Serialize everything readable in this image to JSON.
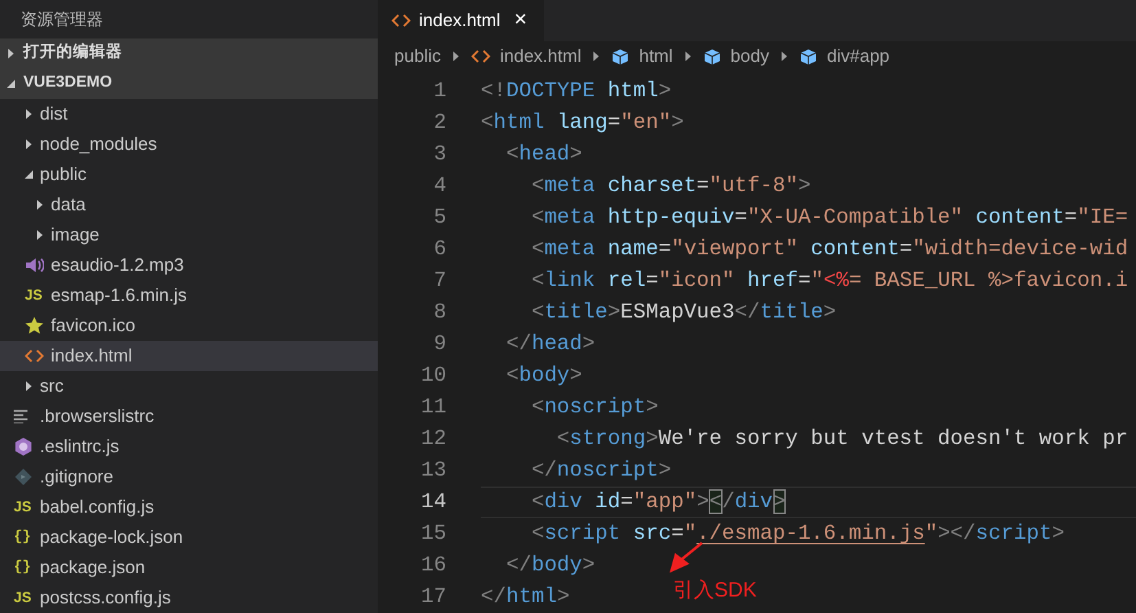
{
  "explorer": {
    "title": "资源管理器",
    "sections": [
      {
        "label": "打开的编辑器",
        "expanded": false
      },
      {
        "label": "VUE3DEMO",
        "expanded": true,
        "children": [
          {
            "label": "dist",
            "kind": "folder",
            "expanded": false,
            "selected": false
          },
          {
            "label": "node_modules",
            "kind": "folder",
            "expanded": false,
            "selected": false
          },
          {
            "label": "public",
            "kind": "folder",
            "expanded": true,
            "selected": false,
            "children": [
              {
                "label": "data",
                "kind": "folder",
                "expanded": false,
                "selected": false
              },
              {
                "label": "image",
                "kind": "folder",
                "expanded": false,
                "selected": false
              },
              {
                "label": "esaudio-1.2.mp3",
                "kind": "audio",
                "selected": false
              },
              {
                "label": "esmap-1.6.min.js",
                "kind": "js",
                "icon": "JS",
                "selected": false
              },
              {
                "label": "favicon.ico",
                "kind": "star",
                "selected": false
              },
              {
                "label": "index.html",
                "kind": "html",
                "selected": true
              }
            ]
          },
          {
            "label": "src",
            "kind": "folder",
            "expanded": false,
            "selected": false
          },
          {
            "label": ".browserslistrc",
            "kind": "text",
            "selected": false
          },
          {
            "label": ".eslintrc.js",
            "kind": "eslint",
            "selected": false
          },
          {
            "label": ".gitignore",
            "kind": "git",
            "selected": false
          },
          {
            "label": "babel.config.js",
            "kind": "js",
            "icon": "JS",
            "selected": false
          },
          {
            "label": "package-lock.json",
            "kind": "json",
            "icon": "{}",
            "selected": false
          },
          {
            "label": "package.json",
            "kind": "json",
            "icon": "{}",
            "selected": false
          },
          {
            "label": "postcss.config.js",
            "kind": "js",
            "icon": "JS",
            "selected": false
          }
        ]
      }
    ]
  },
  "tabs": [
    {
      "label": "index.html",
      "selected": true,
      "close": "×"
    }
  ],
  "breadcrumbs": [
    {
      "label": "public",
      "kind": "folder"
    },
    {
      "label": "index.html",
      "kind": "html"
    },
    {
      "label": "html",
      "kind": "element"
    },
    {
      "label": "body",
      "kind": "element"
    },
    {
      "label": "div#app",
      "kind": "element"
    }
  ],
  "code": [
    {
      "number": "1",
      "current": false,
      "tokens": [
        {
          "kind": "punct",
          "text": "<!"
        },
        {
          "kind": "tag",
          "text": "DOCTYPE"
        },
        {
          "kind": "attr",
          "text": " html"
        },
        {
          "kind": "punct",
          "text": ">"
        }
      ]
    },
    {
      "number": "2",
      "current": false,
      "tokens": [
        {
          "kind": "punct",
          "text": "<"
        },
        {
          "kind": "tag",
          "text": "html"
        },
        {
          "kind": "attr",
          "text": " lang"
        },
        {
          "kind": "plain",
          "text": "="
        },
        {
          "kind": "string",
          "text": "\"en\""
        },
        {
          "kind": "punct",
          "text": ">"
        }
      ]
    },
    {
      "number": "3",
      "current": false,
      "tokens": [
        {
          "kind": "punct",
          "text": "  <"
        },
        {
          "kind": "tag",
          "text": "head"
        },
        {
          "kind": "punct",
          "text": ">"
        }
      ]
    },
    {
      "number": "4",
      "current": false,
      "tokens": [
        {
          "kind": "punct",
          "text": "    <"
        },
        {
          "kind": "tag",
          "text": "meta"
        },
        {
          "kind": "attr",
          "text": " charset"
        },
        {
          "kind": "plain",
          "text": "="
        },
        {
          "kind": "string",
          "text": "\"utf-8\""
        },
        {
          "kind": "punct",
          "text": ">"
        }
      ]
    },
    {
      "number": "5",
      "current": false,
      "tokens": [
        {
          "kind": "punct",
          "text": "    <"
        },
        {
          "kind": "tag",
          "text": "meta"
        },
        {
          "kind": "attr",
          "text": " http-equiv"
        },
        {
          "kind": "plain",
          "text": "="
        },
        {
          "kind": "string",
          "text": "\"X-UA-Compatible\""
        },
        {
          "kind": "attr",
          "text": " content"
        },
        {
          "kind": "plain",
          "text": "="
        },
        {
          "kind": "string",
          "text": "\"IE="
        }
      ]
    },
    {
      "number": "6",
      "current": false,
      "tokens": [
        {
          "kind": "punct",
          "text": "    <"
        },
        {
          "kind": "tag",
          "text": "meta"
        },
        {
          "kind": "attr",
          "text": " name"
        },
        {
          "kind": "plain",
          "text": "="
        },
        {
          "kind": "string",
          "text": "\"viewport\""
        },
        {
          "kind": "attr",
          "text": " content"
        },
        {
          "kind": "plain",
          "text": "="
        },
        {
          "kind": "string",
          "text": "\"width=device-wid"
        }
      ]
    },
    {
      "number": "7",
      "current": false,
      "tokens": [
        {
          "kind": "punct",
          "text": "    <"
        },
        {
          "kind": "tag",
          "text": "link"
        },
        {
          "kind": "attr",
          "text": " rel"
        },
        {
          "kind": "plain",
          "text": "="
        },
        {
          "kind": "string",
          "text": "\"icon\""
        },
        {
          "kind": "attr",
          "text": " href"
        },
        {
          "kind": "plain",
          "text": "="
        },
        {
          "kind": "string",
          "text": "\""
        },
        {
          "kind": "template",
          "text": "<%"
        },
        {
          "kind": "string",
          "text": "= BASE_URL %>favicon.i"
        }
      ]
    },
    {
      "number": "8",
      "current": false,
      "tokens": [
        {
          "kind": "punct",
          "text": "    <"
        },
        {
          "kind": "tag",
          "text": "title"
        },
        {
          "kind": "punct",
          "text": ">"
        },
        {
          "kind": "plain",
          "text": "ESMapVue3"
        },
        {
          "kind": "punct",
          "text": "</"
        },
        {
          "kind": "tag",
          "text": "title"
        },
        {
          "kind": "punct",
          "text": ">"
        }
      ]
    },
    {
      "number": "9",
      "current": false,
      "tokens": [
        {
          "kind": "punct",
          "text": "  </"
        },
        {
          "kind": "tag",
          "text": "head"
        },
        {
          "kind": "punct",
          "text": ">"
        }
      ]
    },
    {
      "number": "10",
      "current": false,
      "tokens": [
        {
          "kind": "punct",
          "text": "  <"
        },
        {
          "kind": "tag",
          "text": "body"
        },
        {
          "kind": "punct",
          "text": ">"
        }
      ]
    },
    {
      "number": "11",
      "current": false,
      "tokens": [
        {
          "kind": "punct",
          "text": "    <"
        },
        {
          "kind": "tag",
          "text": "noscript"
        },
        {
          "kind": "punct",
          "text": ">"
        }
      ]
    },
    {
      "number": "12",
      "current": false,
      "tokens": [
        {
          "kind": "punct",
          "text": "      <"
        },
        {
          "kind": "tag",
          "text": "strong"
        },
        {
          "kind": "punct",
          "text": ">"
        },
        {
          "kind": "plain",
          "text": "We're sorry but vtest doesn't work pr"
        }
      ]
    },
    {
      "number": "13",
      "current": false,
      "tokens": [
        {
          "kind": "punct",
          "text": "    </"
        },
        {
          "kind": "tag",
          "text": "noscript"
        },
        {
          "kind": "punct",
          "text": ">"
        }
      ]
    },
    {
      "number": "14",
      "current": true,
      "tokens": [
        {
          "kind": "punct",
          "text": "    <"
        },
        {
          "kind": "tag",
          "text": "div"
        },
        {
          "kind": "attr",
          "text": " id"
        },
        {
          "kind": "plain",
          "text": "="
        },
        {
          "kind": "string",
          "text": "\"app\""
        },
        {
          "kind": "punct",
          "text": ">"
        },
        {
          "kind": "match",
          "text": "<"
        },
        {
          "kind": "punct",
          "text": "/"
        },
        {
          "kind": "tag",
          "text": "div"
        },
        {
          "kind": "match",
          "text": ">"
        }
      ]
    },
    {
      "number": "15",
      "current": false,
      "tokens": [
        {
          "kind": "punct",
          "text": "    <"
        },
        {
          "kind": "tag",
          "text": "script"
        },
        {
          "kind": "attr",
          "text": " src"
        },
        {
          "kind": "plain",
          "text": "="
        },
        {
          "kind": "string",
          "text": "\""
        },
        {
          "kind": "link",
          "text": "./esmap-1.6.min.js"
        },
        {
          "kind": "string",
          "text": "\""
        },
        {
          "kind": "punct",
          "text": "></"
        },
        {
          "kind": "tag",
          "text": "script"
        },
        {
          "kind": "punct",
          "text": ">"
        }
      ]
    },
    {
      "number": "16",
      "current": false,
      "tokens": [
        {
          "kind": "punct",
          "text": "  </"
        },
        {
          "kind": "tag",
          "text": "body"
        },
        {
          "kind": "punct",
          "text": ">"
        }
      ]
    },
    {
      "number": "17",
      "current": false,
      "tokens": [
        {
          "kind": "punct",
          "text": "</"
        },
        {
          "kind": "tag",
          "text": "html"
        },
        {
          "kind": "punct",
          "text": ">"
        }
      ]
    }
  ],
  "annotation": {
    "text": "引入SDK"
  }
}
